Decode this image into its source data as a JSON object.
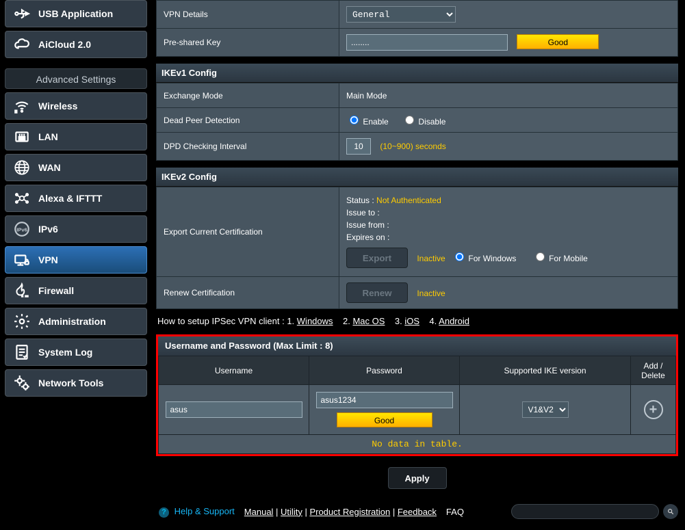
{
  "sidebar": {
    "general": [
      {
        "label": "USB Application"
      },
      {
        "label": "AiCloud 2.0"
      }
    ],
    "adv_header": "Advanced Settings",
    "advanced": [
      {
        "label": "Wireless"
      },
      {
        "label": "LAN"
      },
      {
        "label": "WAN"
      },
      {
        "label": "Alexa & IFTTT"
      },
      {
        "label": "IPv6"
      },
      {
        "label": "VPN",
        "selected": true
      },
      {
        "label": "Firewall"
      },
      {
        "label": "Administration"
      },
      {
        "label": "System Log"
      },
      {
        "label": "Network Tools"
      }
    ]
  },
  "vpn": {
    "details_label": "VPN Details",
    "details_selected": "General",
    "psk_label": "Pre-shared Key",
    "psk_value": "........",
    "psk_strength": "Good"
  },
  "ikev1": {
    "header": "IKEv1 Config",
    "exchange_label": "Exchange Mode",
    "exchange_value": "Main Mode",
    "dpd_label": "Dead Peer Detection",
    "dpd_enable": "Enable",
    "dpd_disable": "Disable",
    "dpd_interval_label": "DPD Checking Interval",
    "dpd_interval_value": "10",
    "dpd_interval_hint": "(10~900) seconds"
  },
  "ikev2": {
    "header": "IKEv2 Config",
    "export_label": "Export Current Certification",
    "status_label": "Status :",
    "status_value": "Not Authenticated",
    "issue_to": "Issue to :",
    "issue_from": "Issue from :",
    "expires": "Expires on :",
    "export_btn": "Export",
    "export_state": "Inactive",
    "for_windows": "For Windows",
    "for_mobile": "For Mobile",
    "renew_label": "Renew Certification",
    "renew_btn": "Renew",
    "renew_state": "Inactive"
  },
  "howto": {
    "prefix": "How to setup IPSec VPN client : ",
    "items": [
      "Windows",
      "Mac OS",
      "iOS",
      "Android"
    ]
  },
  "usertbl": {
    "header": "Username and Password (Max Limit : 8)",
    "col_user": "Username",
    "col_pass": "Password",
    "col_ike": "Supported IKE version",
    "col_add": "Add / Delete",
    "row_user": "asus",
    "row_pass": "asus1234",
    "row_strength": "Good",
    "row_ike": "V1&V2",
    "nodata": "No data in table."
  },
  "actions": {
    "apply": "Apply"
  },
  "footer": {
    "help": "Help & Support",
    "manual": "Manual",
    "utility": "Utility",
    "product_reg": "Product Registration",
    "feedback": "Feedback",
    "faq": "FAQ"
  }
}
